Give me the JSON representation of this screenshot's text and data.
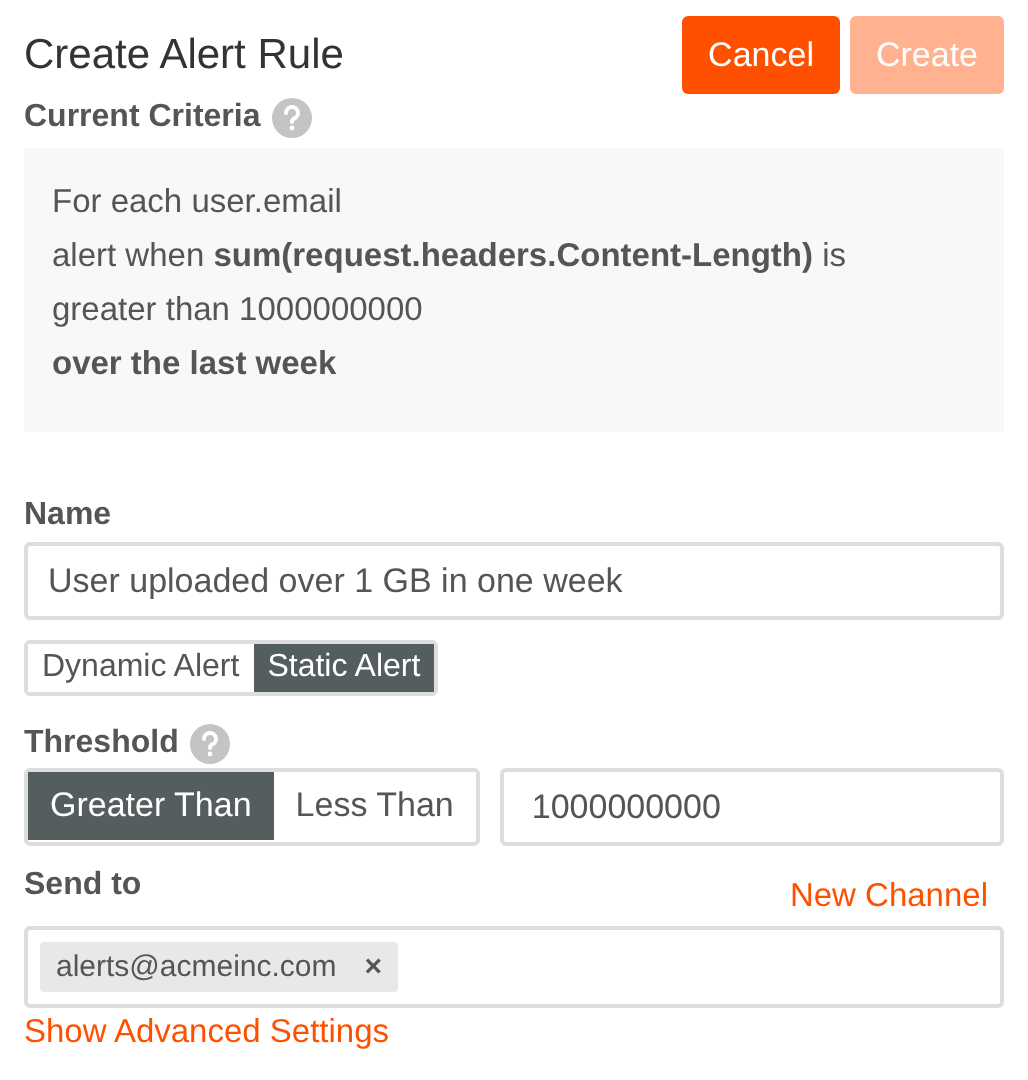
{
  "title": "Create Alert Rule",
  "buttons": [
    {
      "label": "Cancel",
      "disabled": false
    },
    {
      "label": "Create",
      "disabled": true
    }
  ],
  "criteria": {
    "label": "Current Criteria",
    "lines": [
      "For each user.email",
      "alert when **sum(request.headers.Content-Length)** is",
      "greater than 1000000000",
      "**over the last week**"
    ]
  },
  "name": {
    "label": "Name",
    "value": "User uploaded over 1 GB in one week"
  },
  "alert_types": [
    {
      "label": "Dynamic Alert",
      "selected": false
    },
    {
      "label": "Static Alert",
      "selected": true
    }
  ],
  "threshold": {
    "label": "Threshold",
    "operators": [
      {
        "label": "Greater Than",
        "selected": true
      },
      {
        "label": "Less Than",
        "selected": false
      }
    ],
    "value": "1000000000"
  },
  "send_to": {
    "label": "Send to",
    "new_channel": "New Channel",
    "tags": [
      {
        "label": "alerts@acmeinc.com",
        "remove": "×"
      }
    ]
  },
  "advanced_link": "Show Advanced Settings"
}
